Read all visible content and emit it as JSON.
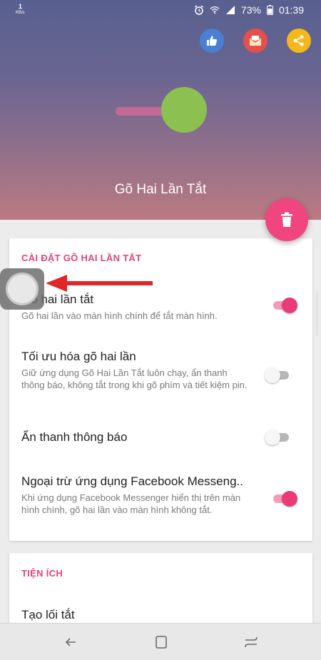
{
  "status_bar": {
    "speed": "1",
    "speed_unit": "KB/s",
    "battery": "73%",
    "time": "01:39"
  },
  "header": {
    "title": "Gõ Hai Lần Tắt",
    "colors": {
      "like": "#4a7fd4",
      "mail": "#e4504c",
      "share": "#f5b81c",
      "fab": "#f0457f"
    }
  },
  "settings_card": {
    "section_title": "CÀI ĐẶT GÕ HAI LẦN TẮT",
    "items": [
      {
        "title": "Gõ hai lần tắt",
        "desc": "Gõ hai lần vào màn hình chính để tắt màn hình.",
        "enabled": true
      },
      {
        "title": "Tối ưu hóa gõ hai lần",
        "desc": "Giữ ứng dụng Gõ Hai Lần Tắt luôn chạy, ẩn thanh thông báo, không tắt trong khi gõ phím và tiết kiệm pin.",
        "enabled": false
      },
      {
        "title": "Ẩn thanh thông báo",
        "desc": "",
        "enabled": false
      },
      {
        "title": "Ngoại trừ ứng dụng Facebook Messeng..",
        "desc": "Khi ứng dụng Facebook Messenger hiển thị trên màn hình chính, gõ hai lần vào màn hình không tắt.",
        "enabled": true
      }
    ]
  },
  "utilities_card": {
    "section_title": "TIỆN ÍCH",
    "items": [
      {
        "title": "Tạo lối tắt"
      }
    ]
  },
  "accent_color": "#e0447c"
}
